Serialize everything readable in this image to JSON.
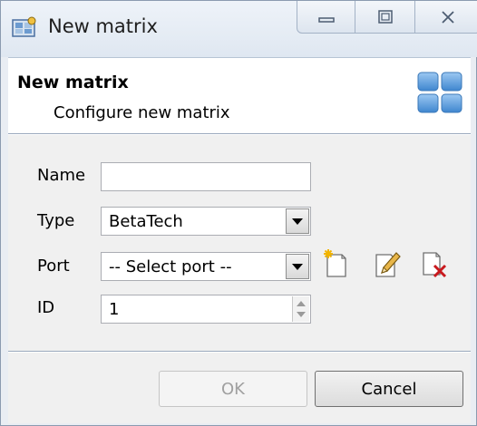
{
  "window": {
    "title": "New matrix",
    "caption_buttons": {
      "minimize": "▭",
      "maximize": "□",
      "close": "✕"
    }
  },
  "header": {
    "title": "New matrix",
    "subtitle": "Configure new matrix",
    "icon": "matrix-grid-icon"
  },
  "form": {
    "name_label": "Name",
    "name_value": "",
    "type_label": "Type",
    "type_value": "BetaTech",
    "port_label": "Port",
    "port_value": "-- Select port --",
    "id_label": "ID",
    "id_value": "1",
    "port_actions": [
      "new-port-icon",
      "edit-port-icon",
      "delete-port-icon"
    ]
  },
  "footer": {
    "ok_label": "OK",
    "ok_enabled": false,
    "cancel_label": "Cancel"
  },
  "colors": {
    "title_bar": "#dfe7f1",
    "form_bg": "#f0f0f0",
    "icon_blue": "#5c9ad6",
    "delete_red": "#c8191e"
  }
}
